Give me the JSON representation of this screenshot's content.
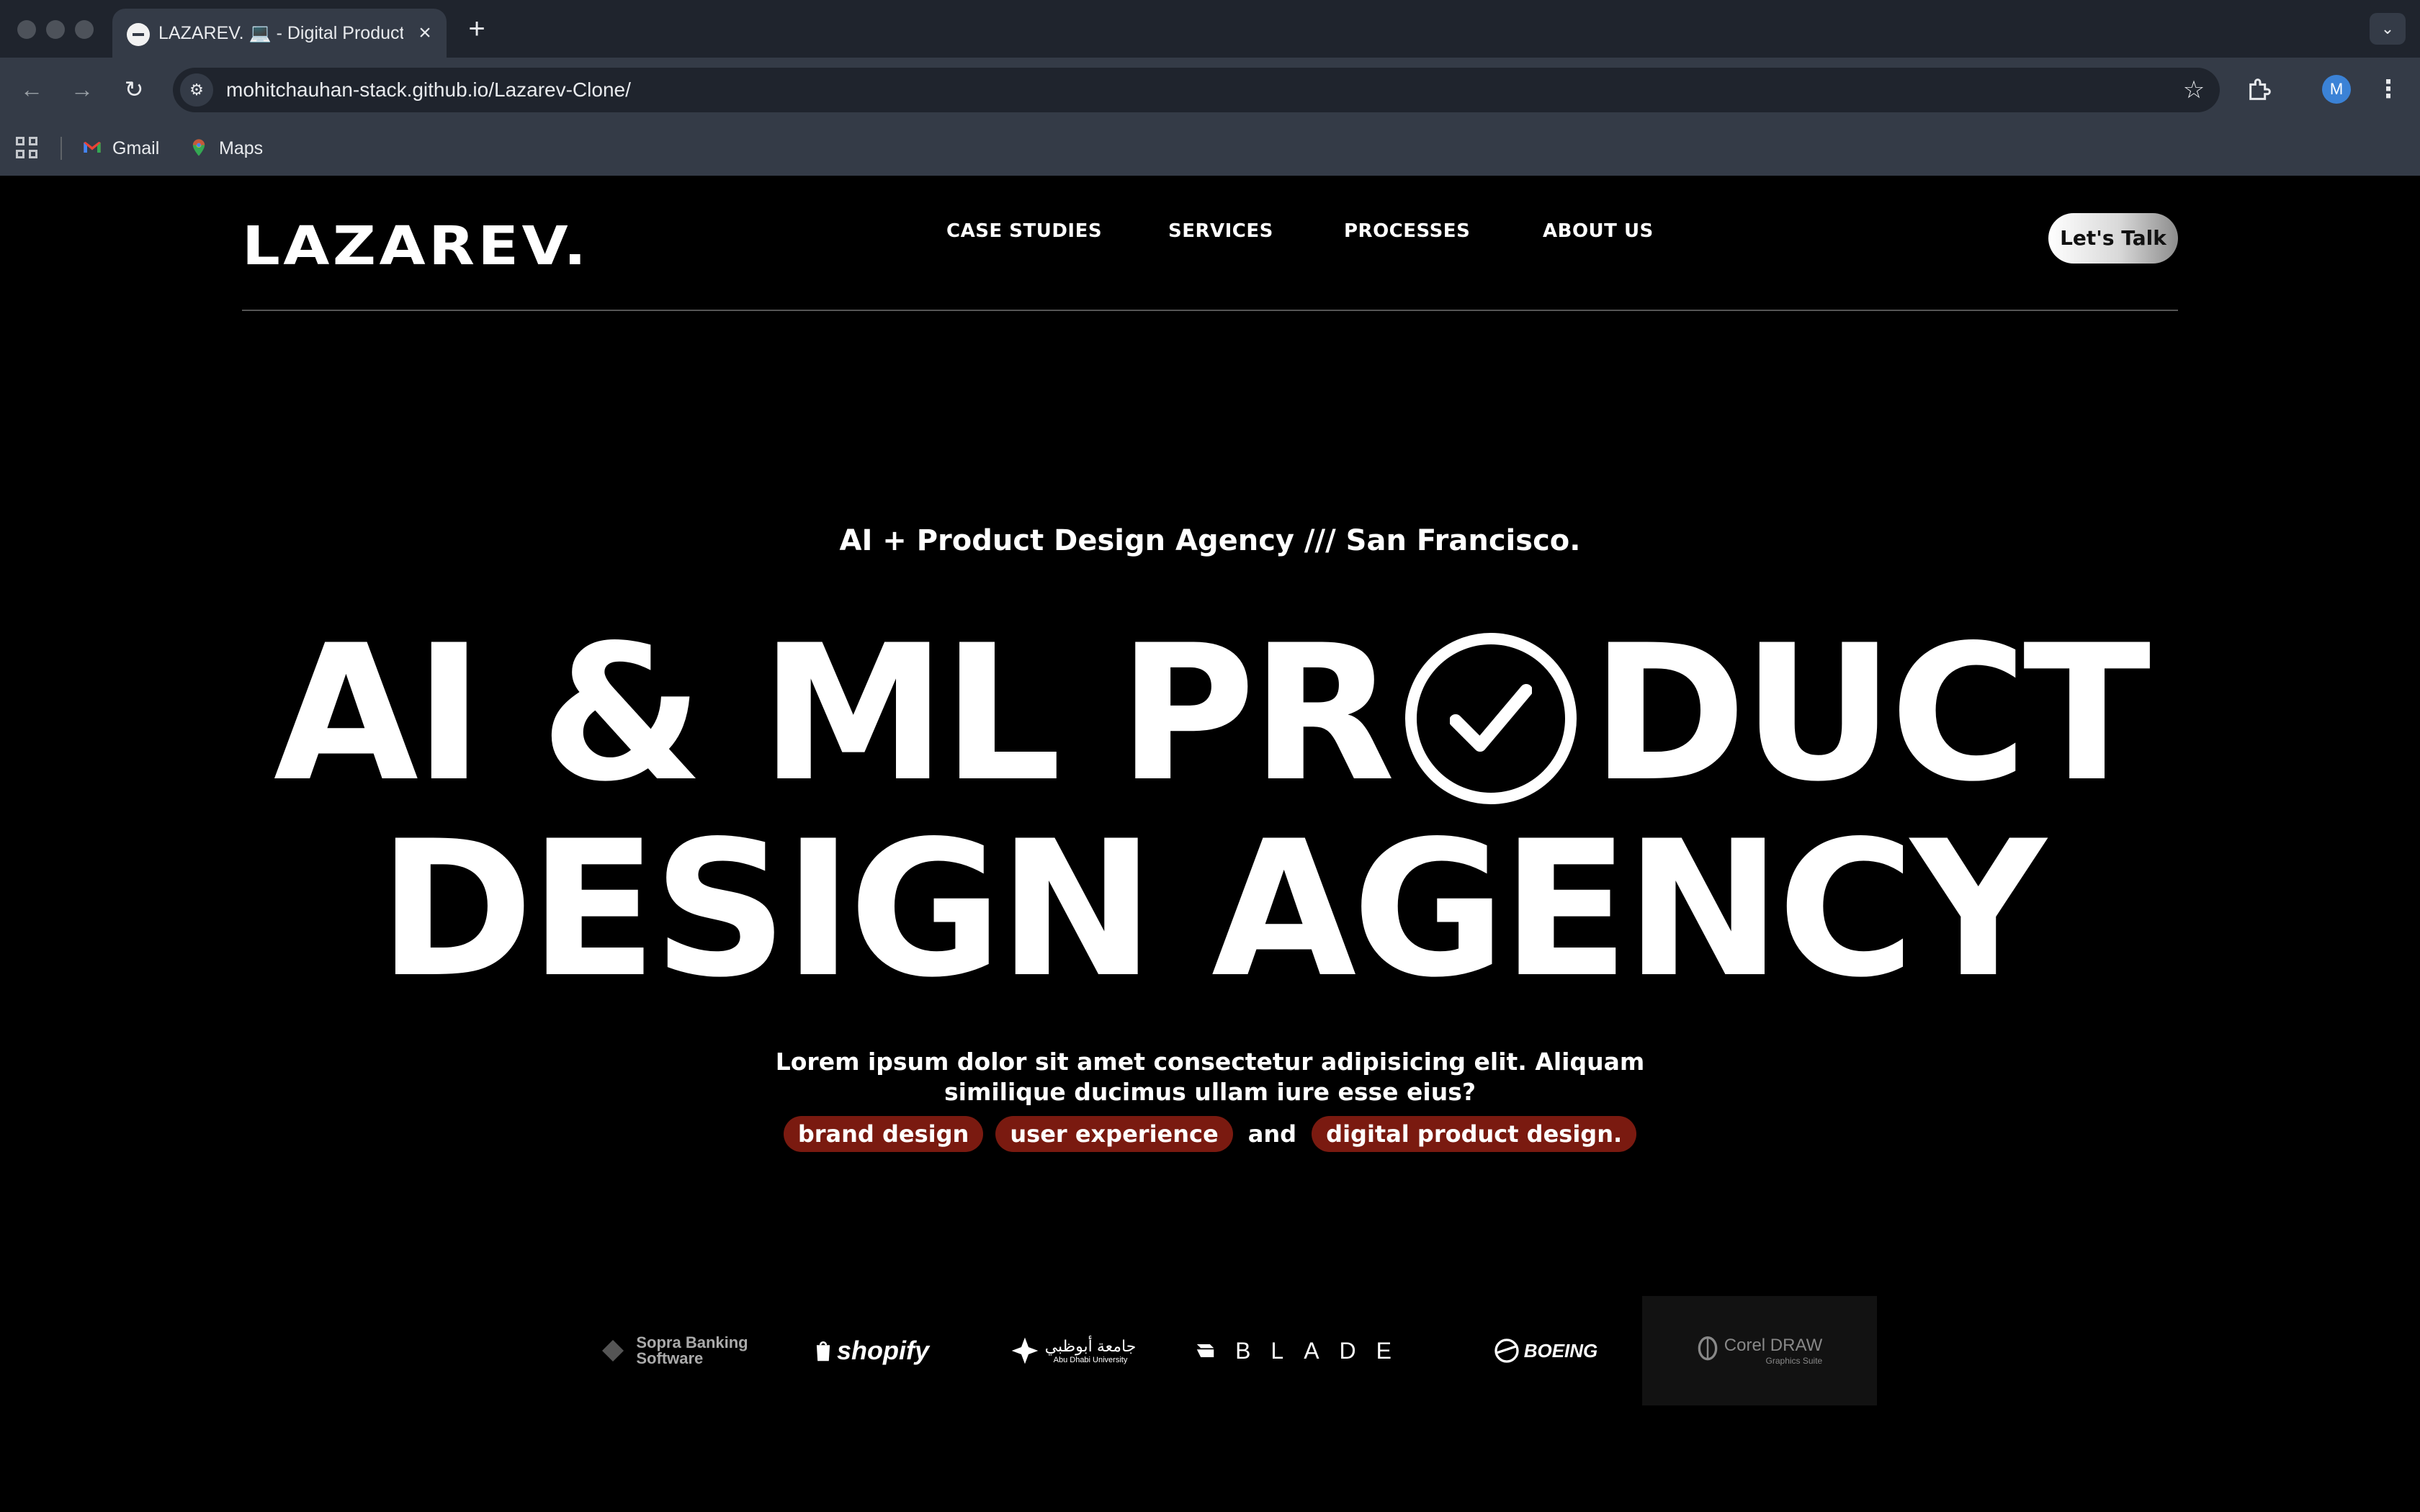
{
  "browser": {
    "tab_title": "LAZAREV. 💻 - Digital Product Design Agency",
    "tab_close": "×",
    "new_tab": "+",
    "url_host": "mohitchauhan-stack.github.io",
    "url_path": "/Lazarev-Clone/",
    "profile_initial": "M",
    "bookmarks": [
      {
        "label": "Gmail",
        "icon": "gmail-icon"
      },
      {
        "label": "Maps",
        "icon": "maps-pin-icon"
      }
    ]
  },
  "site": {
    "logo": "LAZAREV.",
    "nav": [
      "CASE STUDIES",
      "SERVICES",
      "PROCESSES",
      "ABOUT US"
    ],
    "cta": "Let's Talk",
    "tagline": "AI + Product Design Agency /// San Francisco.",
    "headline_line1_a": "AI & ML PR",
    "headline_line1_b": "DUCT",
    "headline_line2": "DESIGN AGENCY",
    "description": "Lorem ipsum dolor sit amet consectetur adipisicing elit. Aliquam similique ducimus ullam iure esse eius?",
    "chips": [
      "brand design",
      "user experience",
      "digital product design."
    ],
    "chips_connector": "and",
    "client_logos": [
      {
        "name": "Sopra Banking Software",
        "line1": "Sopra Banking",
        "line2": "Software"
      },
      {
        "name": "shopify"
      },
      {
        "name": "Abu Dhabi University",
        "arabic": "جامعة أبوظبي",
        "english": "Abu Dhabi University"
      },
      {
        "name": "BLADE"
      },
      {
        "name": "BOEING"
      },
      {
        "name": "Corel DRAW",
        "sub": "Graphics Suite"
      }
    ]
  },
  "colors": {
    "chip_bg": "#7a1a10",
    "page_bg": "#000000",
    "chrome_bg": "#343b47"
  }
}
